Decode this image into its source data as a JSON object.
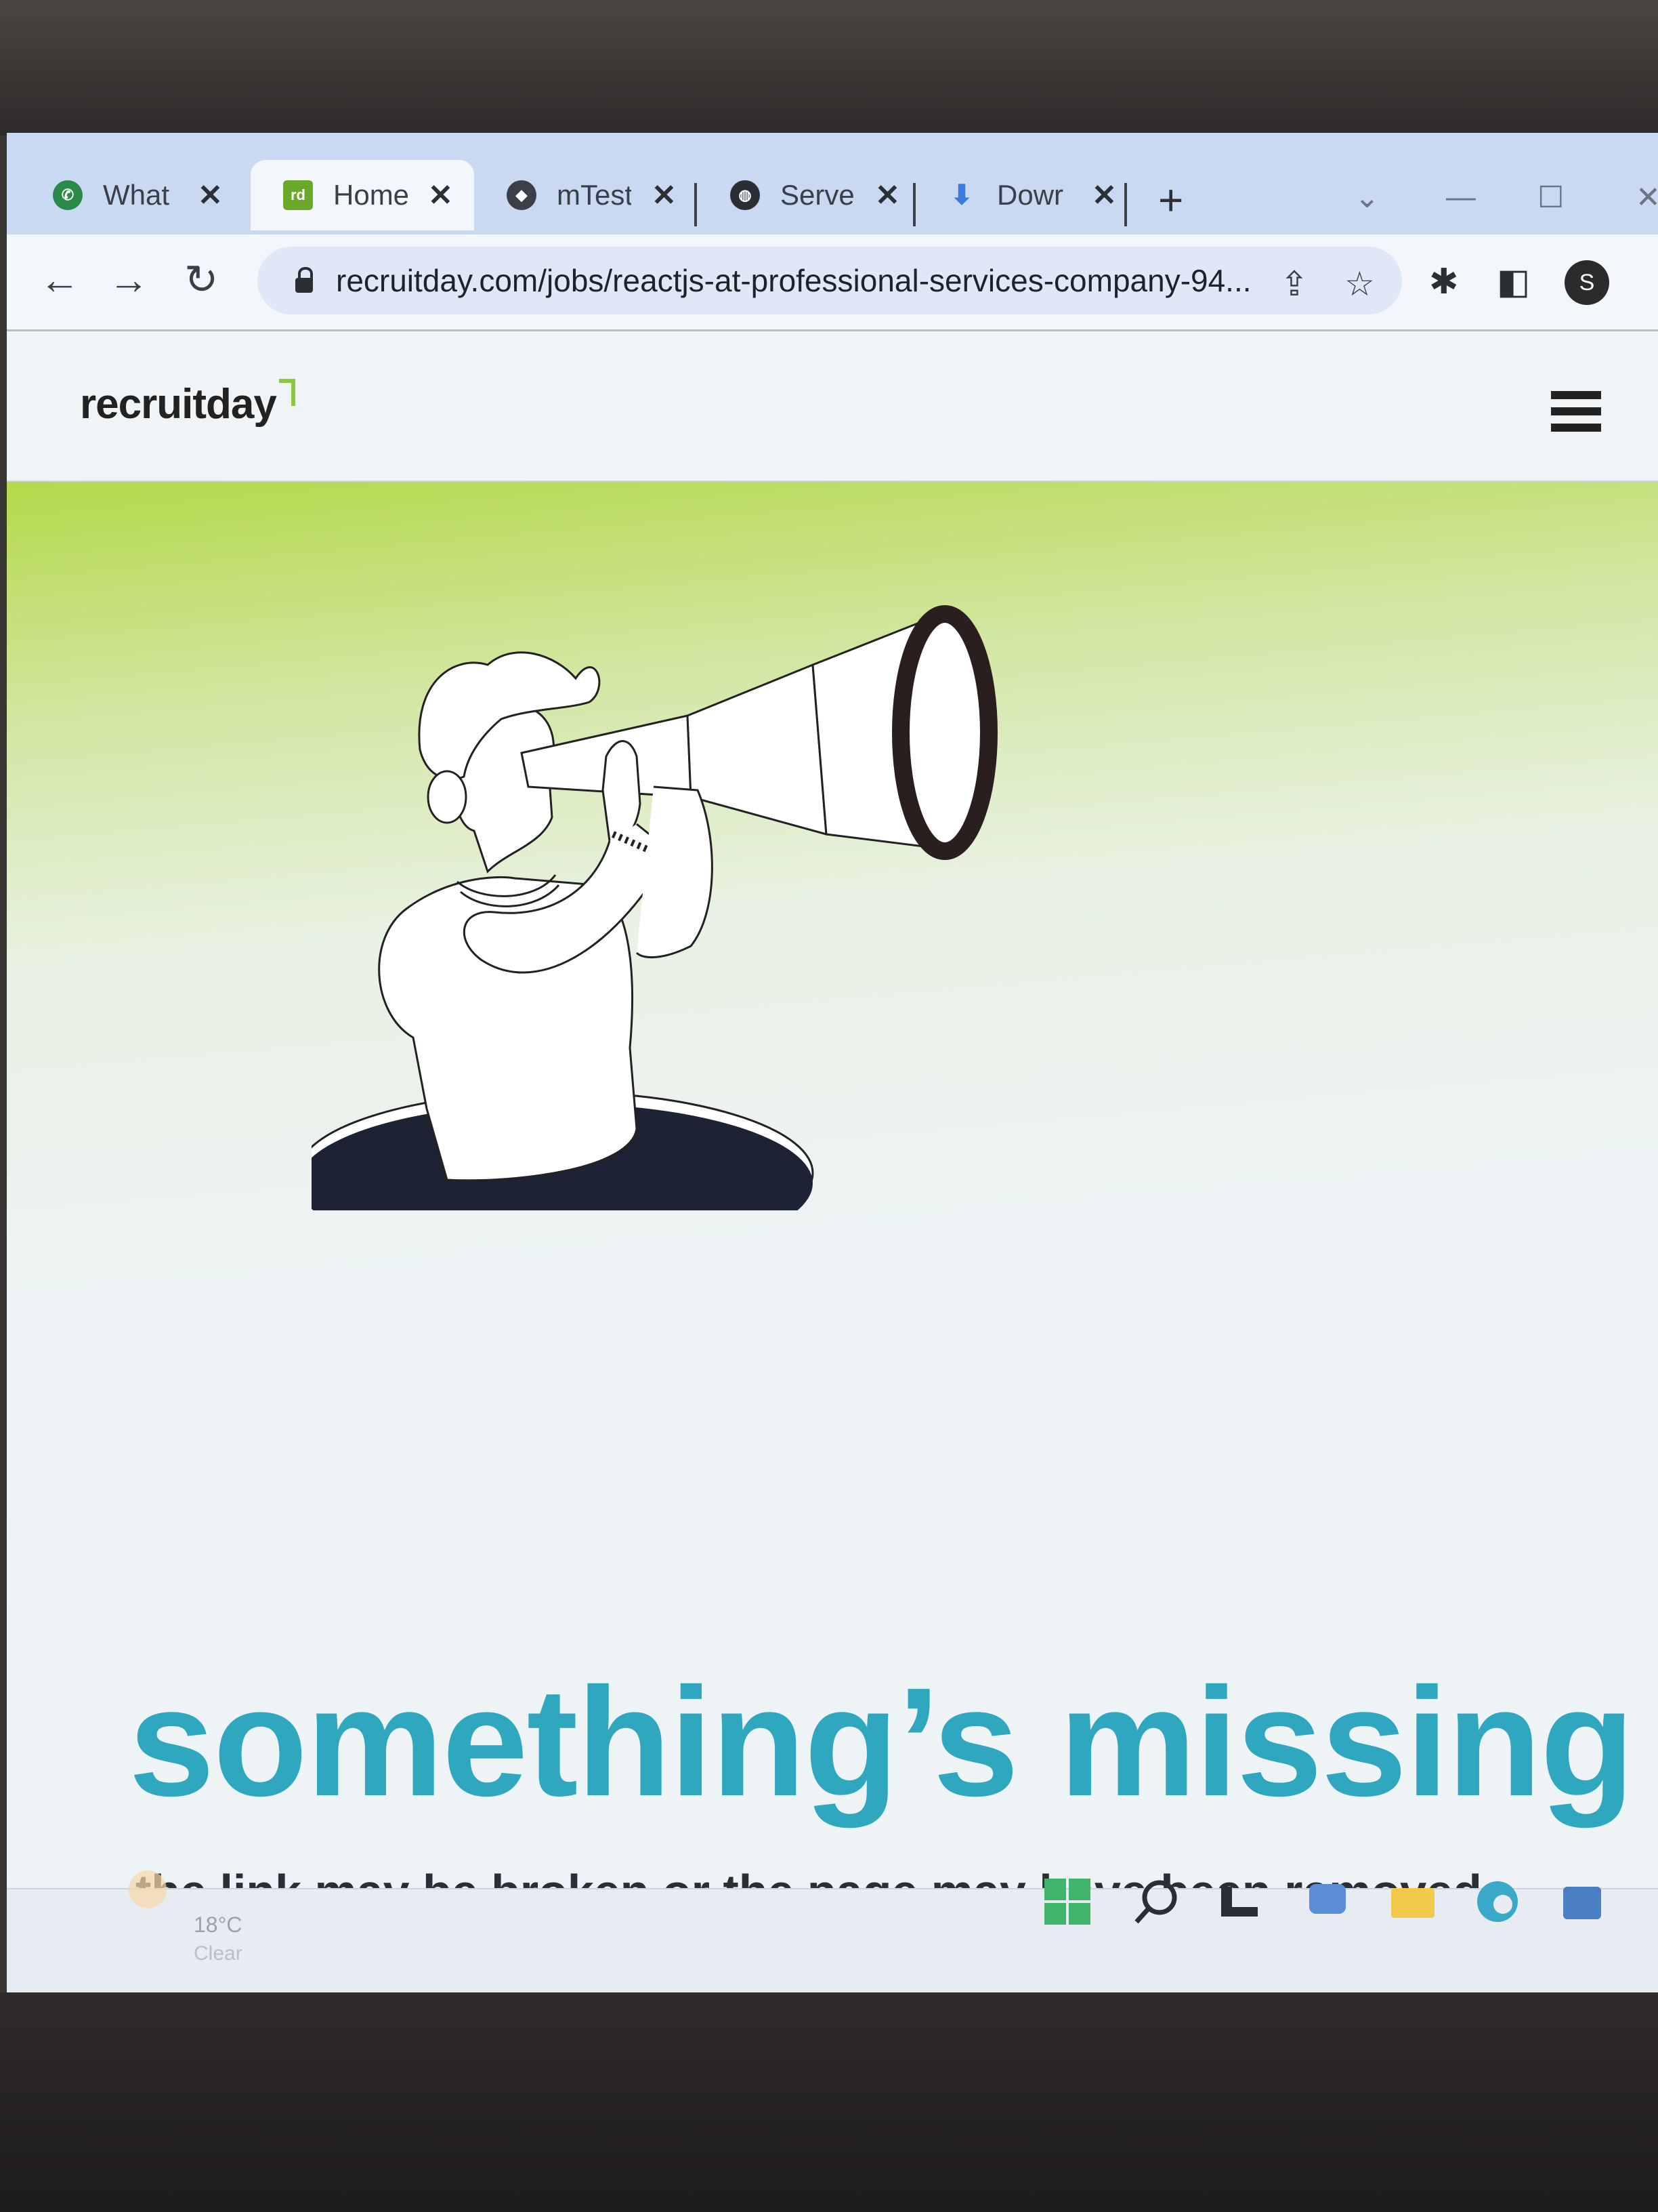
{
  "browser": {
    "tabs": [
      {
        "title": "What",
        "active": false,
        "favicon_color": "#2a8a4a"
      },
      {
        "title": "Home",
        "active": true,
        "favicon_color": "#6aa82a",
        "favicon_text": "rd"
      },
      {
        "title": "mTest",
        "active": false,
        "favicon_color": "#3a3f48"
      },
      {
        "title": "Serve",
        "active": false,
        "favicon_color": "#2b2e33"
      },
      {
        "title": "Dowr",
        "active": false,
        "favicon_color": "#3b7be0"
      }
    ],
    "close_glyph": "✕",
    "new_tab_glyph": "+",
    "url": "recruitday.com/jobs/reactjs-at-professional-services-company-94...",
    "profile_initial": "S"
  },
  "site": {
    "logo": "recruitday",
    "heading": "something’s missing",
    "subheading": "the link may be broken or the page may have been removed"
  },
  "taskbar": {
    "temperature": "18°C",
    "weather": "Clear"
  },
  "colors": {
    "accent": "#2fa8bf",
    "brand_green": "#8dc63f"
  }
}
